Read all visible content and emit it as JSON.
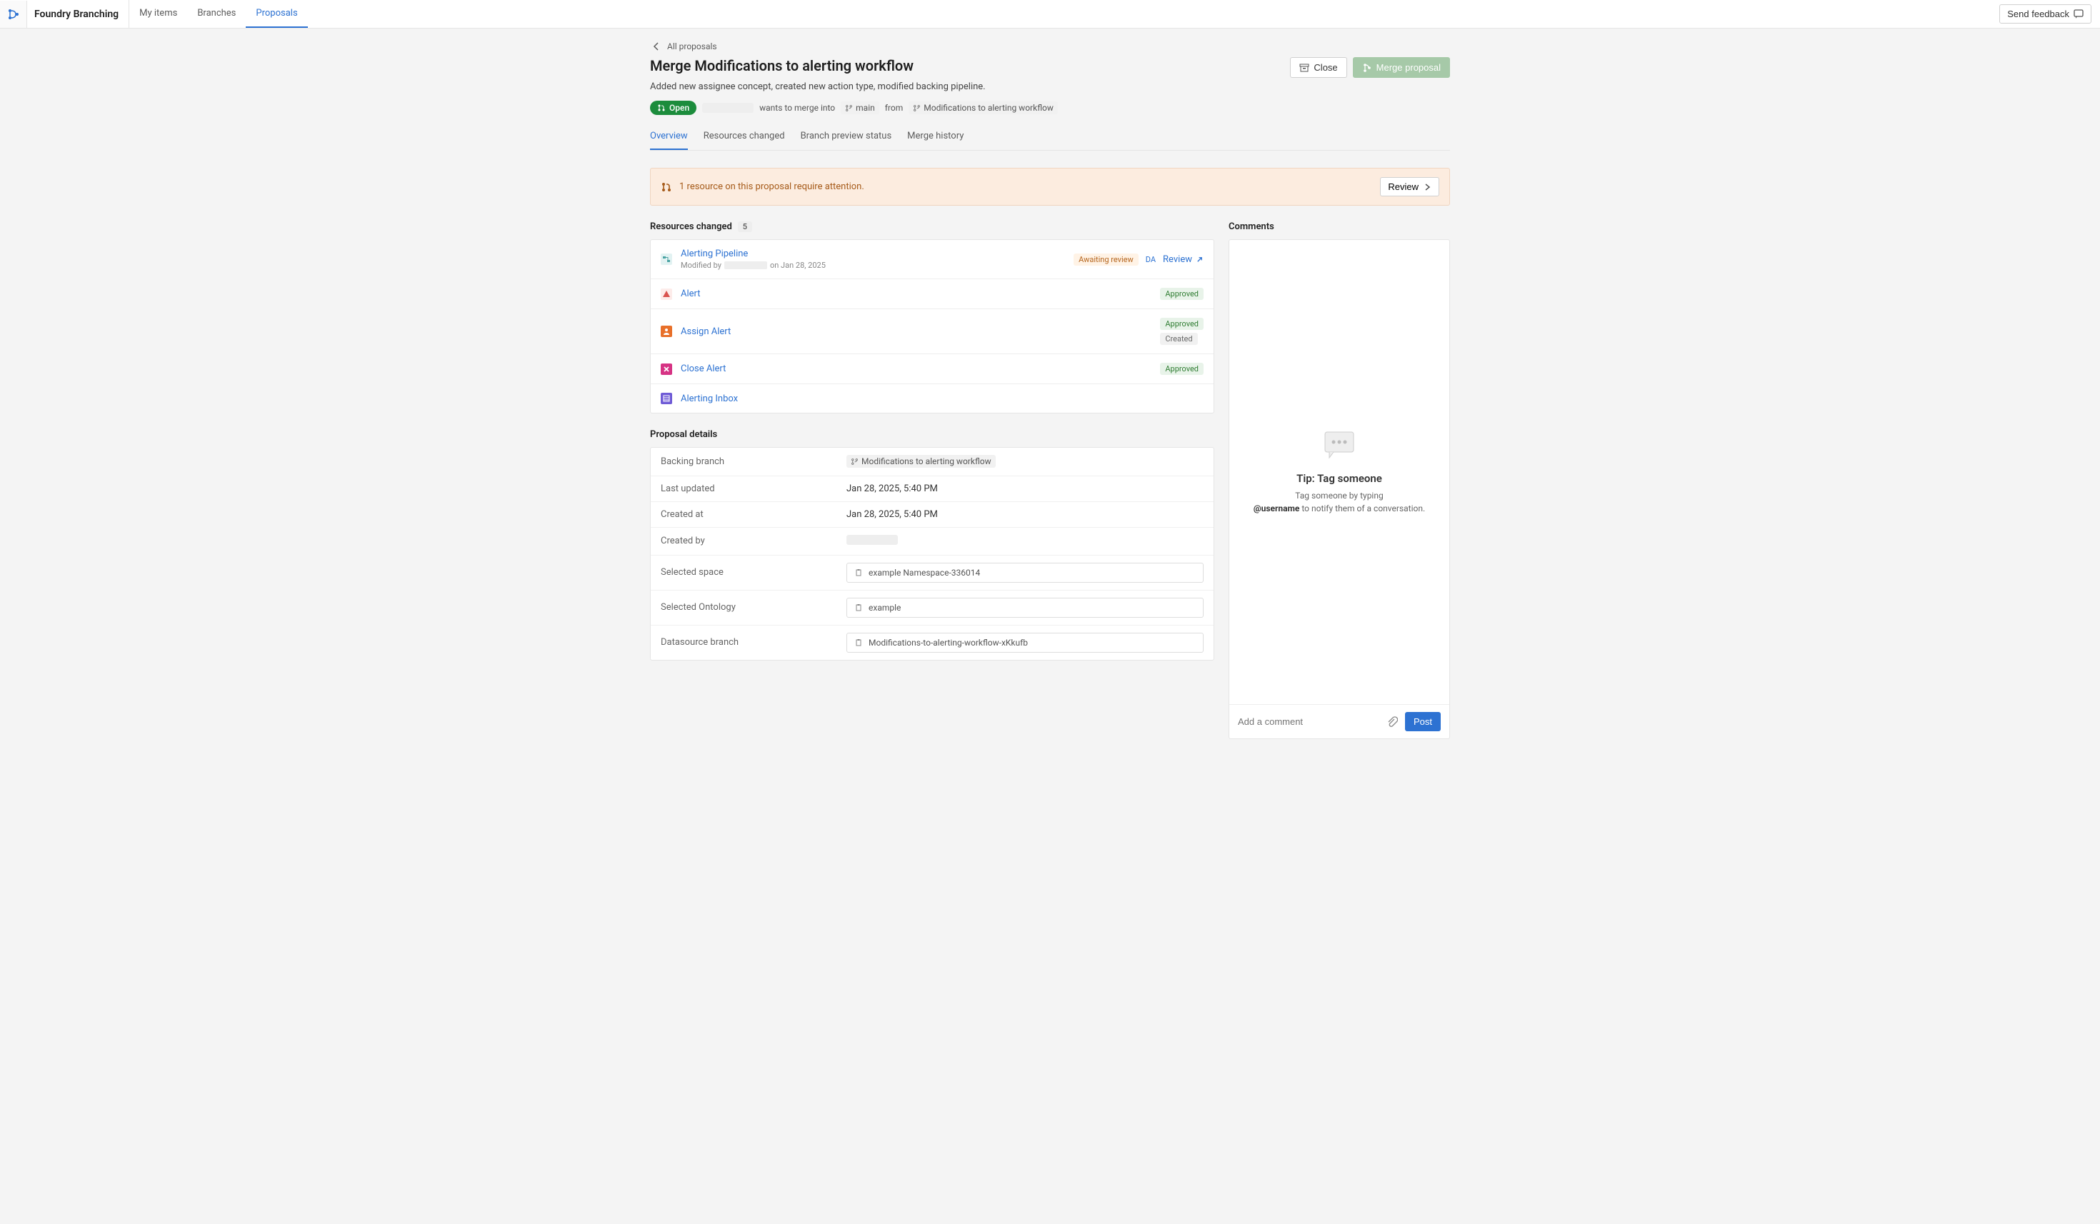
{
  "app": {
    "title": "Foundry Branching",
    "tabs": [
      "My items",
      "Branches",
      "Proposals"
    ],
    "active_tab": "Proposals",
    "feedback": "Send feedback"
  },
  "proposal": {
    "back": "All proposals",
    "title": "Merge Modifications to alerting workflow",
    "desc": "Added new assignee concept, created new action type, modified backing pipeline.",
    "close_btn": "Close",
    "merge_btn": "Merge proposal",
    "status": "Open",
    "merge_text_1": "wants to merge into",
    "target_branch": "main",
    "merge_text_2": "from",
    "source_branch": "Modifications to alerting workflow"
  },
  "subtabs": {
    "items": [
      "Overview",
      "Resources changed",
      "Branch preview status",
      "Merge history"
    ],
    "active": "Overview"
  },
  "banner": {
    "text": "1 resource on this proposal require attention.",
    "button": "Review"
  },
  "resources": {
    "heading": "Resources changed",
    "count": "5",
    "items": [
      {
        "name": "Alerting Pipeline",
        "modified_prefix": "Modified by",
        "modified_suffix": "on Jan 28, 2025",
        "badges": [
          {
            "t": "Awaiting review",
            "c": "await"
          }
        ],
        "da": "DA",
        "review": "Review",
        "icon_color": "#4aa3a3",
        "icon_bg": "#e2f2f2"
      },
      {
        "name": "Alert",
        "badges": [
          {
            "t": "Approved",
            "c": "approved"
          }
        ],
        "icon_color": "#d9534f",
        "icon_bg": "#fdecea"
      },
      {
        "name": "Assign Alert",
        "badges": [
          {
            "t": "Approved",
            "c": "approved"
          },
          {
            "t": "Created",
            "c": "created"
          }
        ],
        "icon_color": "#fff",
        "icon_bg": "#e8702a"
      },
      {
        "name": "Close Alert",
        "badges": [
          {
            "t": "Approved",
            "c": "approved"
          }
        ],
        "icon_color": "#fff",
        "icon_bg": "#d63384"
      },
      {
        "name": "Alerting Inbox",
        "badges": [],
        "icon_color": "#fff",
        "icon_bg": "#6f5bd6"
      }
    ]
  },
  "details": {
    "heading": "Proposal details",
    "rows": {
      "backing_branch_label": "Backing branch",
      "backing_branch_value": "Modifications to alerting workflow",
      "last_updated_label": "Last updated",
      "last_updated_value": "Jan 28, 2025, 5:40 PM",
      "created_at_label": "Created at",
      "created_at_value": "Jan 28, 2025, 5:40 PM",
      "created_by_label": "Created by",
      "selected_space_label": "Selected space",
      "selected_space_value": "example Namespace-336014",
      "selected_ontology_label": "Selected Ontology",
      "selected_ontology_value": "example",
      "datasource_branch_label": "Datasource branch",
      "datasource_branch_value": "Modifications-to-alerting-workflow-xKkufb"
    }
  },
  "comments": {
    "heading": "Comments",
    "tip_title": "Tip: Tag someone",
    "tip_line1": "Tag someone by typing",
    "tip_bold": "@username",
    "tip_line2": " to notify them of a conversation.",
    "placeholder": "Add a comment",
    "post": "Post"
  }
}
